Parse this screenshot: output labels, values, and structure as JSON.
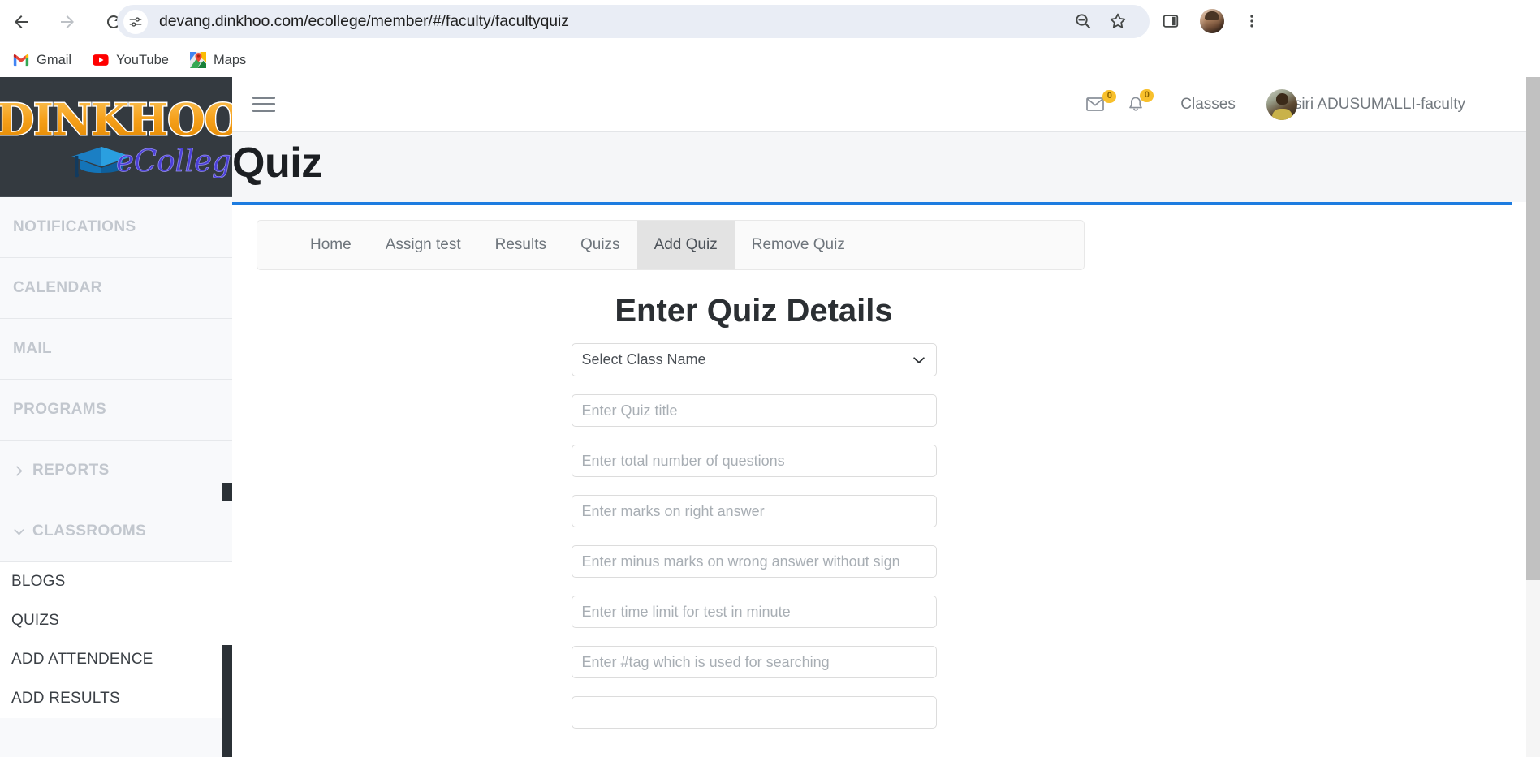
{
  "browser": {
    "url": "devang.dinkhoo.com/ecollege/member/#/faculty/facultyquiz",
    "back_label": "Back",
    "forward_label": "Forward",
    "reload_label": "Reload",
    "site_info_label": "View site information",
    "zoom_label": "Zoom",
    "bookmark_label": "Bookmark this tab",
    "side_panel_label": "Side panel",
    "profile_label": "Profile",
    "menu_label": "Customize and control Google Chrome",
    "bookmarks": [
      {
        "label": "Gmail",
        "icon": "gmail-icon"
      },
      {
        "label": "YouTube",
        "icon": "youtube-icon"
      },
      {
        "label": "Maps",
        "icon": "maps-icon"
      }
    ]
  },
  "sidebar": {
    "logo": {
      "brand": "DINKHOO!",
      "sub": "eCollege"
    },
    "items": [
      {
        "label": "NOTIFICATIONS",
        "caret": "none"
      },
      {
        "label": "CALENDAR",
        "caret": "none"
      },
      {
        "label": "MAIL",
        "caret": "none"
      },
      {
        "label": "PROGRAMS",
        "caret": "none"
      },
      {
        "label": "REPORTS",
        "caret": "right"
      },
      {
        "label": "CLASSROOMS",
        "caret": "down"
      }
    ],
    "sub_items": [
      {
        "label": "BLOGS"
      },
      {
        "label": "QUIZS"
      },
      {
        "label": "ADD ATTENDENCE"
      },
      {
        "label": "ADD RESULTS"
      }
    ]
  },
  "topbar": {
    "menu_toggle_label": "Toggle navigation",
    "mail_badge": "0",
    "bell_badge": "0",
    "classes_link": "Classes",
    "username": "siri ADUSUMALLI-faculty"
  },
  "page": {
    "title": "Quiz",
    "accent_color": "#1d7ce0"
  },
  "tabs": [
    {
      "label": "Home",
      "active": false
    },
    {
      "label": "Assign test",
      "active": false
    },
    {
      "label": "Results",
      "active": false
    },
    {
      "label": "Quizs",
      "active": false
    },
    {
      "label": "Add Quiz",
      "active": true
    },
    {
      "label": "Remove Quiz",
      "active": false
    }
  ],
  "form": {
    "heading": "Enter Quiz Details",
    "class_select": {
      "selected": "Select Class Name",
      "options": [
        "Select Class Name"
      ]
    },
    "fields": [
      {
        "name": "quiz-title",
        "placeholder": "Enter Quiz title",
        "value": ""
      },
      {
        "name": "total-questions",
        "placeholder": "Enter total number of questions",
        "value": ""
      },
      {
        "name": "marks-right",
        "placeholder": "Enter marks on right answer",
        "value": ""
      },
      {
        "name": "minus-marks-wrong",
        "placeholder": "Enter minus marks on wrong answer without sign",
        "value": ""
      },
      {
        "name": "time-limit",
        "placeholder": "Enter time limit for test in minute",
        "value": ""
      },
      {
        "name": "search-tag",
        "placeholder": "Enter #tag which is used for searching",
        "value": ""
      }
    ]
  }
}
